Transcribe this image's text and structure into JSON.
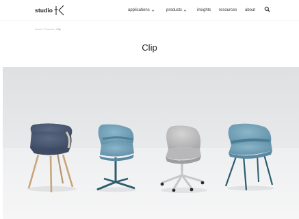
{
  "header": {
    "logo_text": "studio",
    "nav": [
      {
        "label": "applications",
        "has_dropdown": true
      },
      {
        "label": "products",
        "has_dropdown": true
      },
      {
        "label": "insights",
        "has_dropdown": false
      },
      {
        "label": "resources",
        "has_dropdown": false
      },
      {
        "label": "about",
        "has_dropdown": false
      }
    ],
    "search_icon": "search-icon"
  },
  "breadcrumb": {
    "home": "Home",
    "sep1": "/",
    "products": "Products",
    "sep2": "/",
    "current": "Clip"
  },
  "page": {
    "title": "Clip"
  },
  "hero": {
    "chairs": [
      {
        "style": "wood-leg",
        "color": "#4a5a72"
      },
      {
        "style": "four-star-base",
        "color": "#7ba7bc"
      },
      {
        "style": "five-star-castors",
        "color": "#c8c8c8"
      },
      {
        "style": "four-leg-metal",
        "color": "#7ba7bc"
      }
    ],
    "colors": {
      "backdrop": "#e6e7e9",
      "floor": "#f2f2f3"
    }
  }
}
